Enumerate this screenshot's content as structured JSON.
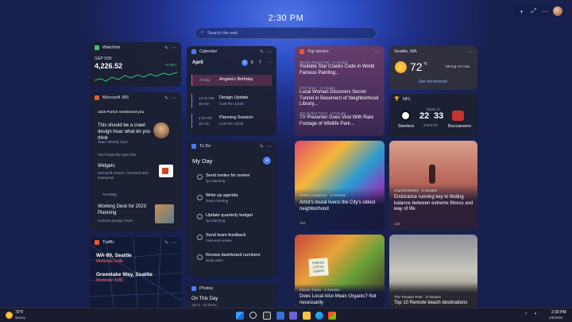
{
  "clock": "2:30 PM",
  "search": {
    "placeholder": "Search the web"
  },
  "topbar": {
    "add": "+",
    "expand": "⤢",
    "more": "⋯"
  },
  "watchlist": {
    "title": "Watchlist",
    "symbol": "S&P 500",
    "price": "4,226.52",
    "change": "+0.08%"
  },
  "m365": {
    "title": "Microsoft 365",
    "mention_label": "Jack Purton mentioned you",
    "mention_text": "This should be a crawl design hsac what do you think",
    "mention_source": "Team Weekly Sync",
    "opened_label": "You frequently open this",
    "doc1_title": "Widgets",
    "doc1_sub": "Microsoft Search, Assistant and Enterprise",
    "trending_label": "Trending",
    "doc2_title": "Working Deck for 2023 Planning",
    "doc2_sub": "Contoso Design Team"
  },
  "traffic": {
    "title": "Traffic",
    "line1": "WA-99, Seattle",
    "line1_status": "Moderate traffic",
    "line2": "Greenlake Way, Seattle",
    "line2_status": "Moderate traffic"
  },
  "calendar": {
    "title": "Calendar",
    "month": "April",
    "days": [
      "5",
      "6",
      "7"
    ],
    "events": [
      {
        "time": "All day",
        "title": "Angela's Birthday",
        "sub": ""
      },
      {
        "time": "12:30 PM",
        "dur": "30 min",
        "title": "Design Update",
        "sub": "Conf Rm 32/35"
      },
      {
        "time": "4:30 PM",
        "dur": "30 min",
        "title": "Planning Session",
        "sub": "Conf Rm 32/35"
      }
    ]
  },
  "todo": {
    "title": "To Do",
    "list": "My Day",
    "tasks": [
      {
        "t": "Send invites for review",
        "s": "Q4 planning"
      },
      {
        "t": "Write up agenda",
        "s": "Team meeting"
      },
      {
        "t": "Update quarterly budget",
        "s": "Q4 planning"
      },
      {
        "t": "Send team feedback",
        "s": "Year-end review"
      },
      {
        "t": "Review dashboard numbers",
        "s": "Daily tasks"
      }
    ]
  },
  "photos": {
    "title": "Photos",
    "heading": "On This Day",
    "sub": "Apr 5 · 33 items"
  },
  "topstories": {
    "title": "Top stories",
    "items": [
      {
        "src": "Weekly News Post · 3 minutes",
        "title": "Youtube Star Cracks Code in World Famous Painting..."
      },
      {
        "src": "XYZ News · 3 minutes",
        "title": "Local Woman Discovers Secret Tunnel in Basement of Neighborhood Library..."
      },
      {
        "src": "The Global Times · 3 minutes",
        "title": "TV Presenter Goes Viral With Rare Footage of Wildlife Park..."
      }
    ]
  },
  "weather": {
    "title": "Seattle, WA",
    "temp": "72",
    "unit": "°F",
    "cond": "Strong UV now",
    "link": "See full forecast"
  },
  "nfl": {
    "title": "NFL",
    "status": "Week 11",
    "team1": "Steelers",
    "team2": "Buccaneers",
    "score1": "22",
    "score2": "33",
    "time": "2nd 8:00"
  },
  "mural": {
    "src": "Artistry Magazine · 3 minutes",
    "title": "Artist's mural livens the City's oldest neighborhood",
    "reactions": "284"
  },
  "endurance": {
    "src": "Journal Weekly · 3 minutes",
    "title": "Endurance running key to finding balance between extreme fitness and way of life",
    "reactions": "189"
  },
  "organic": {
    "src": "Citizen Times · 3 minutes",
    "title": "Does Local Also Mean Organic? Not necessarily",
    "sign": "FRESH LOCAL organic"
  },
  "remote": {
    "src": "The Traveler Post · 3 minutes",
    "title": "Top 10 Remote beach destinations"
  },
  "taskbar": {
    "temp": "72°F",
    "cond": "Sunny",
    "time": "2:30 PM",
    "date": "4/5/2022"
  },
  "colors": {
    "accent": "#4a7bff",
    "positive": "#2ecc71",
    "traffic": "#ff6b6b"
  }
}
